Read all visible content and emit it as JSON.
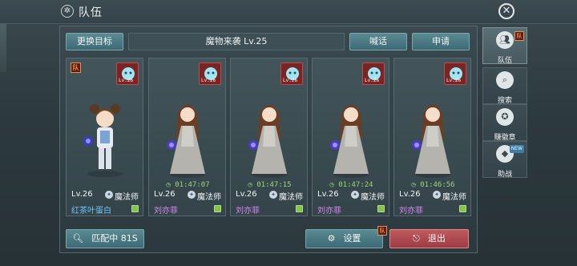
{
  "window": {
    "title": "队伍",
    "close_icon": "close-icon"
  },
  "panel": {
    "change_target_label": "更换目标",
    "activity_label": "魔物来袭 Lv.25",
    "shout_label": "喊话",
    "apply_label": "申请"
  },
  "members": [
    {
      "is_leader": true,
      "leader_badge": "队",
      "pet_level": "Lv.26",
      "timer": "",
      "level": "Lv.26",
      "job": "魔法师",
      "name": "红茶叶蛋白",
      "name_color": "#6fc4f5"
    },
    {
      "is_leader": false,
      "pet_level": "Lv.26",
      "timer": "01:47:07",
      "level": "Lv.26",
      "job": "魔法师",
      "name": "刘亦菲",
      "name_color": "#d488f0"
    },
    {
      "is_leader": false,
      "pet_level": "Lv.26",
      "timer": "01:47:15",
      "level": "Lv.26",
      "job": "魔法师",
      "name": "刘亦菲",
      "name_color": "#d488f0"
    },
    {
      "is_leader": false,
      "pet_level": "Lv.26",
      "timer": "01:47:24",
      "level": "Lv.26",
      "job": "魔法师",
      "name": "刘亦菲",
      "name_color": "#d488f0"
    },
    {
      "is_leader": false,
      "pet_level": "Lv.26",
      "timer": "01:46:56",
      "level": "Lv.26",
      "job": "魔法师",
      "name": "刘亦菲",
      "name_color": "#d488f0"
    }
  ],
  "bottom": {
    "match_label": "匹配中 81S",
    "settings_label": "设置",
    "settings_badge": "队",
    "exit_label": "退出"
  },
  "side_tabs": [
    {
      "label": "队伍",
      "icon": "team-icon",
      "active": true,
      "badge": "队"
    },
    {
      "label": "搜索",
      "icon": "search-icon",
      "active": false
    },
    {
      "label": "赚徽章",
      "icon": "medal-icon",
      "active": false
    },
    {
      "label": "助战",
      "icon": "diamond-icon",
      "active": false,
      "tag": "NEW"
    }
  ],
  "colors": {
    "accent_teal": "#4d7d87",
    "exit_red": "#b04a50",
    "leader_name": "#6fc4f5",
    "member_name": "#d488f0",
    "timer_green": "#9ed07b"
  }
}
